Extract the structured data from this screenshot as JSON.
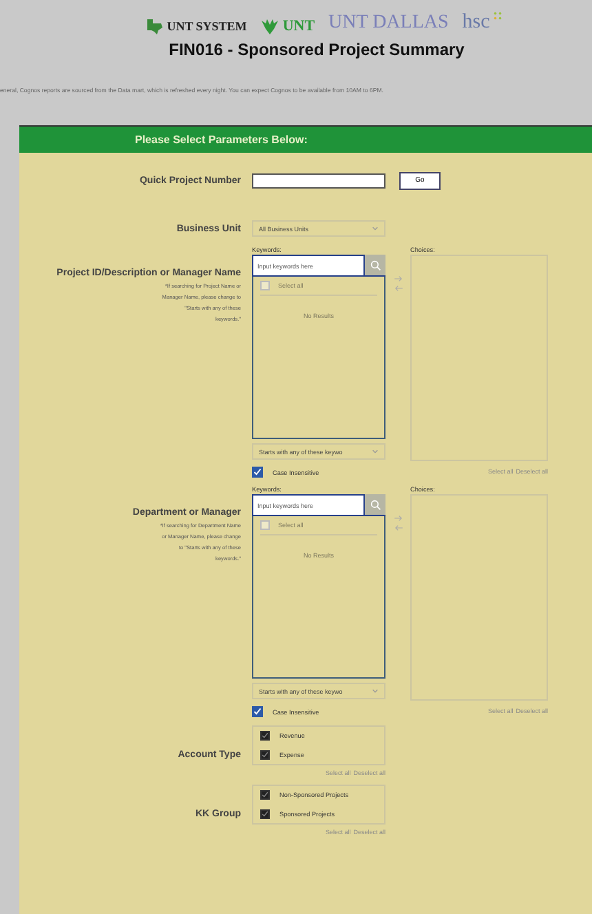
{
  "header": {
    "logos": [
      {
        "kind": "system",
        "text": "UNT SYSTEM"
      },
      {
        "kind": "unt",
        "text": "UNT"
      },
      {
        "kind": "dallas",
        "text": "UNT DALLAS"
      },
      {
        "kind": "hsc",
        "text": "hsc"
      }
    ],
    "title": "FIN016 - Sponsored Project Summary",
    "notice": "eneral, Cognos reports are sourced from the Data mart, which is refreshed every night. You can expect Cognos to be available from 10AM to 6PM."
  },
  "banner": "Please Select Parameters Below:",
  "parameters": [
    {
      "kind": "quick",
      "label": "Quick Project Number",
      "button": "Go"
    },
    {
      "kind": "select",
      "label": "Business Unit",
      "value": "All Business Units"
    },
    {
      "kind": "picker",
      "label": "Project ID/Description or Manager Name",
      "note": "*If searching for Project Name or Manager Name, please change to \"Starts with any of these keywords.\"",
      "keywords_label": "Keywords:",
      "placeholder": "Input keywords here",
      "select_all": "Select all",
      "select_all_checked": false,
      "no_results": "No Results",
      "choices_label": "Choices:",
      "match": "Starts with any of these keywo",
      "case_label": "Case Insensitive",
      "case_checked": true,
      "links": [
        "Select all",
        "Deselect all"
      ]
    },
    {
      "kind": "picker",
      "label": "Department or Manager",
      "note": "*If searching for Department Name or Manager Name, please change to \"Starts with any of these keywords.\"",
      "keywords_label": "Keywords:",
      "placeholder": "Input keywords here",
      "select_all": "Select all",
      "select_all_checked": false,
      "no_results": "No Results",
      "choices_label": "Choices:",
      "match": "Starts with any of these keywo",
      "case_label": "Case Insensitive",
      "case_checked": true,
      "links": [
        "Select all",
        "Deselect all"
      ]
    },
    {
      "kind": "checklist",
      "label": "Account Type",
      "options": [
        {
          "label": "Revenue",
          "checked": true
        },
        {
          "label": "Expense",
          "checked": true
        }
      ],
      "links": [
        "Select all",
        "Deselect all"
      ]
    },
    {
      "kind": "checklist",
      "label": "KK Group",
      "options": [
        {
          "label": "Non-Sponsored Projects",
          "checked": true
        },
        {
          "label": "Sponsored Projects",
          "checked": true
        }
      ],
      "links": [
        "Select all",
        "Deselect all"
      ]
    }
  ]
}
